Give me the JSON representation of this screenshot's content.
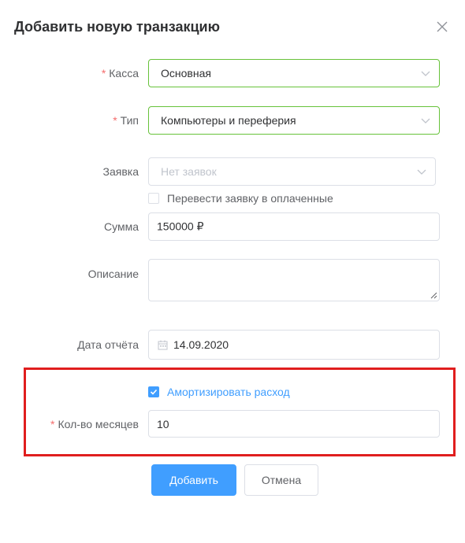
{
  "dialog": {
    "title": "Добавить новую транзакцию"
  },
  "form": {
    "kassa": {
      "label": "Касса",
      "required": true,
      "value": "Основная"
    },
    "type": {
      "label": "Тип",
      "required": true,
      "value": "Компьютеры и переферия"
    },
    "request": {
      "label": "Заявка",
      "placeholder": "Нет заявок"
    },
    "mark_paid": {
      "label": "Перевести заявку в оплаченные",
      "checked": false
    },
    "amount": {
      "label": "Сумма",
      "value": "150000 ₽"
    },
    "description": {
      "label": "Описание",
      "value": ""
    },
    "report_date": {
      "label": "Дата отчёта",
      "value": "14.09.2020"
    },
    "amortize": {
      "label": "Амортизировать расход",
      "checked": true
    },
    "months": {
      "label": "Кол-во месяцев",
      "required": true,
      "value": "10"
    }
  },
  "buttons": {
    "submit": "Добавить",
    "cancel": "Отмена"
  },
  "icons": {
    "close": "close-icon",
    "select_arrow": "chevron-down-icon",
    "date": "calendar-icon",
    "check": "check-icon"
  },
  "colors": {
    "primary": "#409eff",
    "success_border": "#67c23a",
    "required": "#f56c6c",
    "highlight": "#e01e1e"
  }
}
